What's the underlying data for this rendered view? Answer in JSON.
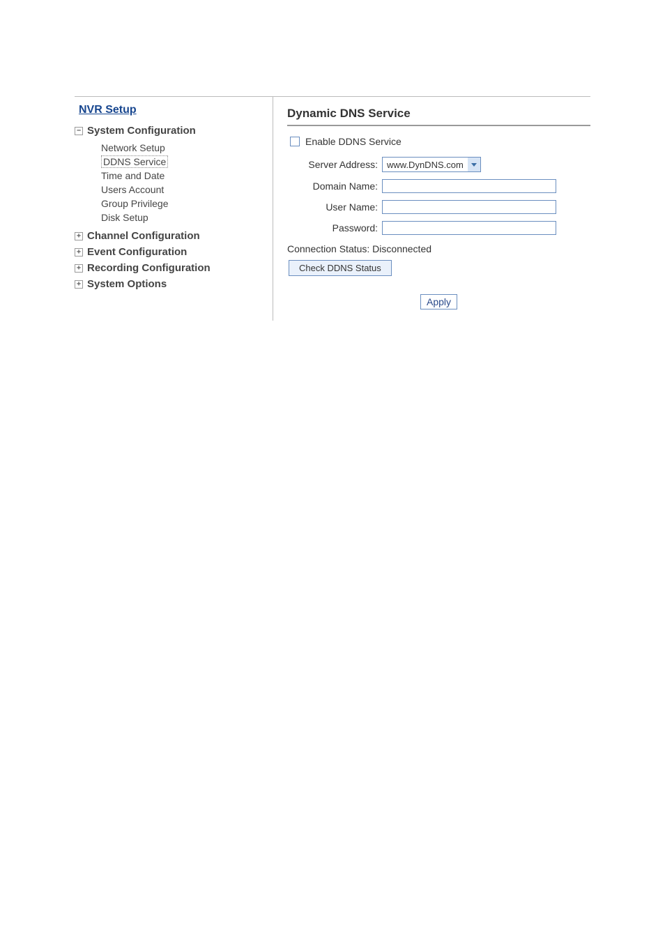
{
  "sidebar": {
    "title": "NVR Setup",
    "sections": [
      {
        "state": "minus",
        "label": "System Configuration",
        "children": [
          {
            "label": "Network Setup",
            "selected": false
          },
          {
            "label": "DDNS Service",
            "selected": true
          },
          {
            "label": "Time and Date",
            "selected": false
          },
          {
            "label": "Users Account",
            "selected": false
          },
          {
            "label": "Group Privilege",
            "selected": false
          },
          {
            "label": "Disk Setup",
            "selected": false
          }
        ]
      },
      {
        "state": "plus",
        "label": "Channel Configuration",
        "children": []
      },
      {
        "state": "plus",
        "label": "Event Configuration",
        "children": []
      },
      {
        "state": "plus",
        "label": "Recording Configuration",
        "children": []
      },
      {
        "state": "plus",
        "label": "System Options",
        "children": []
      }
    ]
  },
  "main": {
    "title": "Dynamic DNS Service",
    "enable_label": "Enable DDNS Service",
    "enable_checked": false,
    "fields": {
      "server_address": {
        "label": "Server Address:",
        "value": "www.DynDNS.com"
      },
      "domain_name": {
        "label": "Domain Name:",
        "value": ""
      },
      "user_name": {
        "label": "User Name:",
        "value": ""
      },
      "password": {
        "label": "Password:",
        "value": ""
      }
    },
    "connection_status": "Connection Status: Disconnected",
    "check_button": "Check DDNS Status",
    "apply_button": "Apply"
  }
}
